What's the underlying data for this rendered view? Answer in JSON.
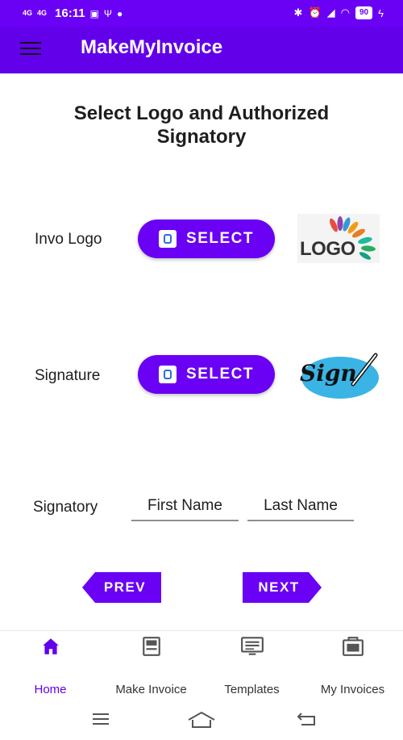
{
  "status_bar": {
    "net1": "4G",
    "net2": "4G",
    "time": "16:11",
    "battery": "90"
  },
  "app_bar": {
    "title": "MakeMyInvoice"
  },
  "page": {
    "title_line1": "Select Logo and Authorized",
    "title_line2": "Signatory"
  },
  "logo_row": {
    "label": "Invo Logo",
    "button": "SELECT",
    "preview_text": "LOGO"
  },
  "signature_row": {
    "label": "Signature",
    "button": "SELECT",
    "preview_text": "Sign"
  },
  "signatory_row": {
    "label": "Signatory",
    "first_name_placeholder": "First Name",
    "last_name_placeholder": "Last Name"
  },
  "navigation": {
    "prev": "PREV",
    "next": "NEXT"
  },
  "bottom_nav": {
    "tabs": [
      {
        "label": "Home",
        "icon": "home-icon",
        "active": true
      },
      {
        "label": "Make Invoice",
        "icon": "invoice-icon",
        "active": false
      },
      {
        "label": "Templates",
        "icon": "templates-icon",
        "active": false
      },
      {
        "label": "My Invoices",
        "icon": "my-invoices-icon",
        "active": false
      }
    ]
  },
  "colors": {
    "primary": "#6200ea",
    "button": "#6a00f4",
    "active_tab": "#6200ea"
  }
}
